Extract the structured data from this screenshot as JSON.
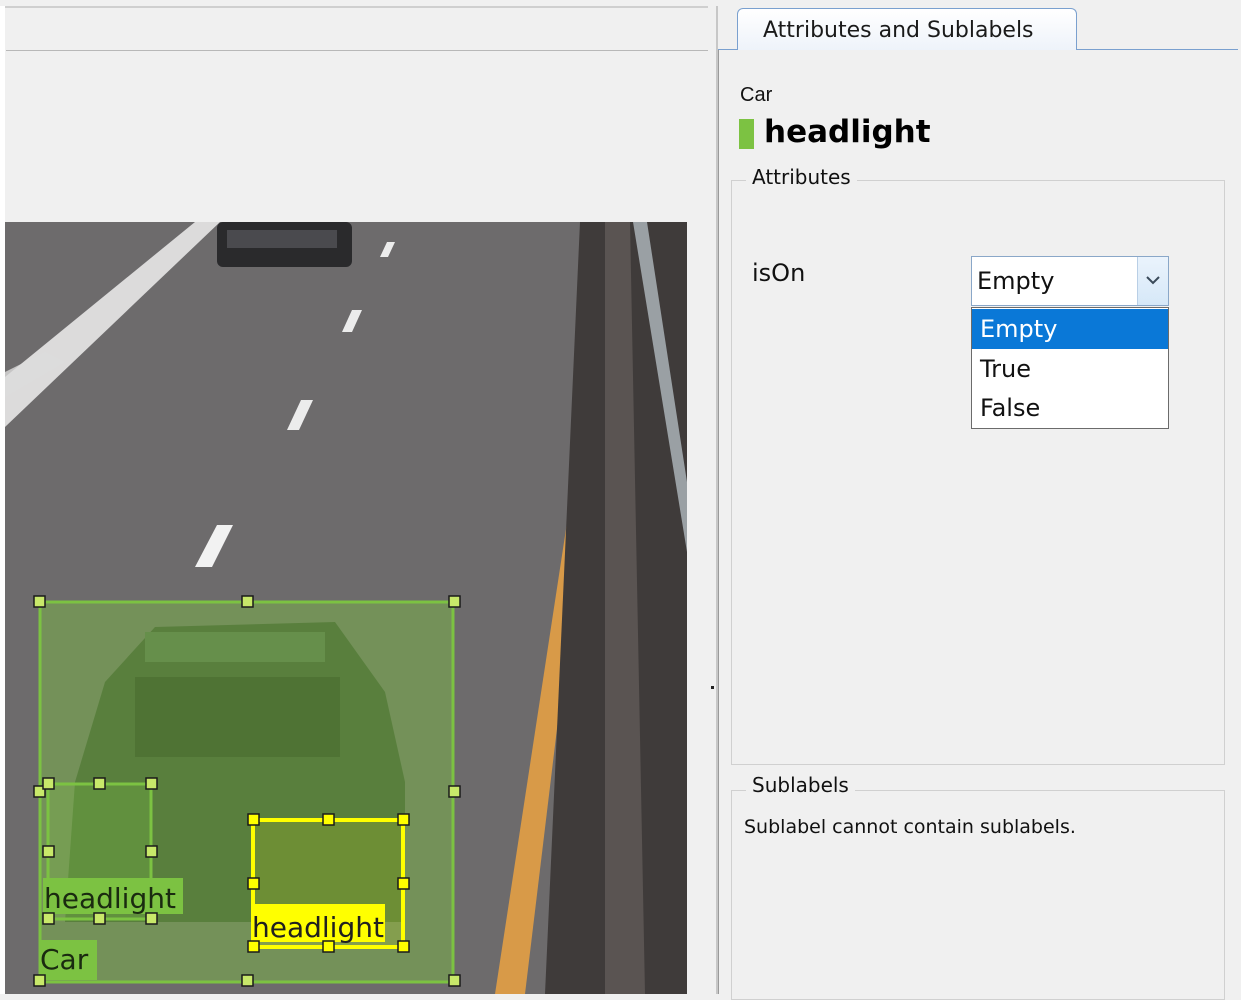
{
  "tab": {
    "label": "Attributes and Sublabels"
  },
  "selection": {
    "parent_label": "Car",
    "label_name": "headlight",
    "label_color": "#7cc242"
  },
  "attributes_group": {
    "title": "Attributes",
    "attribute": {
      "name": "isOn",
      "value": "Empty",
      "options": [
        "Empty",
        "True",
        "False"
      ],
      "highlighted_option": "Empty"
    }
  },
  "sublabels_group": {
    "title": "Sublabels",
    "message": "Sublabel cannot contain sublabels."
  },
  "rois": {
    "car": {
      "label": "Car",
      "color": "#7cc242"
    },
    "headlight_left": {
      "label": "headlight",
      "color": "#7cc242"
    },
    "headlight_right": {
      "label": "headlight",
      "color": "#ffff00"
    }
  }
}
